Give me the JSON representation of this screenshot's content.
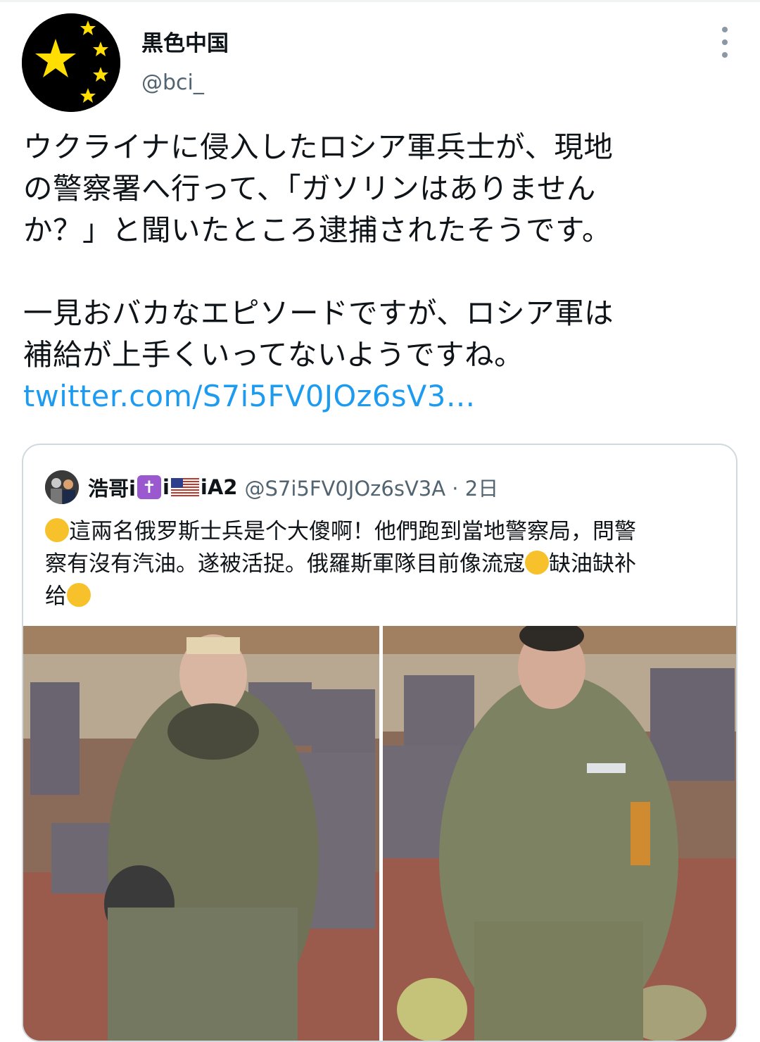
{
  "tweet": {
    "display_name": "黒色中国",
    "handle": "@bci_",
    "text_lines": [
      "ウクライナに侵入したロシア軍兵士が、現地",
      "の警察署へ行って、「ガソリンはありません",
      "か？」と聞いたところ逮捕されたそうです。"
    ],
    "text_lines_2": [
      "一見おバカなエピソードですが、ロシア軍は",
      "補給が上手くいってないようですね。"
    ],
    "link": "twitter.com/S7i5FV0JOz6sV3…"
  },
  "quote": {
    "name_part1": "浩哥i",
    "badge": "✝",
    "name_part2": "i",
    "name_part3": "iA2",
    "handle_time": "@S7i5FV0JOz6sV3A · 2日",
    "line1": "這兩名俄罗斯士兵是个大傻啊！他們跑到當地警察局，問警",
    "line2a": "察有沒有汽油。遂被活捉。俄羅斯軍隊目前像流寇",
    "line2b": "缺油缺补",
    "line3": "给"
  },
  "icons": {
    "avatar": "china-flag-avatar",
    "more": "more-vertical-icon",
    "emoji1": "star-struck-emoji",
    "emoji2": "weary-face-emoji",
    "emoji3": "hugging-face-emoji",
    "flag": "us-flag-icon"
  },
  "colors": {
    "link": "#1d9bf0",
    "secondary": "#536471",
    "border": "#cfd9de",
    "text": "#0f1419"
  }
}
